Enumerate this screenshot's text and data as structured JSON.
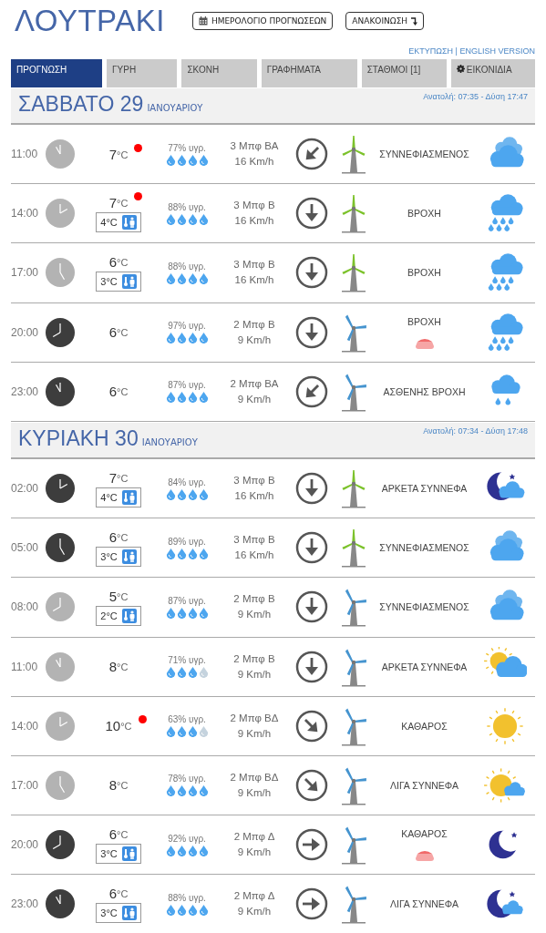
{
  "title": "ΛΟΥΤΡΑΚΙ",
  "header_buttons": [
    {
      "label": "ΗΜΕΡΟΛΟΓΙΟ ΠΡΟΓΝΩΣΕΩΝ",
      "kind": "calendar"
    },
    {
      "label": "ΑΝΑΚΟΙΝΩΣΗ",
      "kind": "announce"
    }
  ],
  "links": [
    "ΕΚΤΥΠΩΣΗ",
    "ENGLISH VERSION"
  ],
  "link_separator": "|",
  "tabs": [
    {
      "label": "ΠΡΟΓΝΩΣΗ",
      "selected": true
    },
    {
      "label": "ΓΥΡΗ",
      "selected": false
    },
    {
      "label": "ΣΚΟΝΗ",
      "selected": false
    },
    {
      "label": "ΓΡΑΦΗΜΑΤΑ",
      "selected": false
    },
    {
      "label": "ΣΤΑΘΜΟΙ  [1]",
      "selected": false
    },
    {
      "label": "ΕΙΚΟΝΙΔΙΑ",
      "selected": false,
      "kind": "gear"
    }
  ],
  "days": [
    {
      "day": "ΣΑΒΒΑΤΟ 29",
      "month": "ΙΑΝΟΥΑΡΙΟΥ",
      "sun": "Ανατολή: 07:35  - Δύση 17:47",
      "rows": [
        {
          "time": "11:00",
          "night": false,
          "temp": "7",
          "unit": "°C",
          "alert": true,
          "humidity": "77% υγρ.",
          "stars": 4,
          "wind_force": "3 Μπφ ΒΑ",
          "wind_speed": "16 Km/h",
          "arrow": {
            "kind": "sw"
          },
          "turbine": {
            "kind": "strong"
          },
          "condition": "ΣΥΝΝΕΦΙΑΣΜΕΝΟΣ",
          "fog": false,
          "weather": {
            "kind": "cloudy"
          }
        },
        {
          "time": "14:00",
          "night": false,
          "temp": "7",
          "unit": "°C",
          "alert": true,
          "feels": "4°C",
          "humidity": "88% υγρ.",
          "stars": 4,
          "wind_force": "3 Μπφ Β",
          "wind_speed": "16 Km/h",
          "arrow": {
            "kind": "s"
          },
          "turbine": {
            "kind": "strong"
          },
          "condition": "ΒΡΟΧΗ",
          "fog": false,
          "weather": {
            "kind": "rain"
          }
        },
        {
          "time": "17:00",
          "night": false,
          "temp": "6",
          "unit": "°C",
          "alert": false,
          "feels": "3°C",
          "humidity": "88% υγρ.",
          "stars": 4,
          "wind_force": "3 Μπφ Β",
          "wind_speed": "16 Km/h",
          "arrow": {
            "kind": "s"
          },
          "turbine": {
            "kind": "strong"
          },
          "condition": "ΒΡΟΧΗ",
          "fog": false,
          "weather": {
            "kind": "rain"
          }
        },
        {
          "time": "20:00",
          "night": true,
          "temp": "6",
          "unit": "°C",
          "alert": false,
          "humidity": "97% υγρ.",
          "stars": 4,
          "wind_force": "2 Μπφ Β",
          "wind_speed": "9 Km/h",
          "arrow": {
            "kind": "s"
          },
          "turbine": {
            "kind": "weak"
          },
          "condition": "ΒΡΟΧΗ",
          "fog": true,
          "weather": {
            "kind": "rain"
          }
        },
        {
          "time": "23:00",
          "night": true,
          "temp": "6",
          "unit": "°C",
          "alert": false,
          "humidity": "87% υγρ.",
          "stars": 4,
          "wind_force": "2 Μπφ ΒΑ",
          "wind_speed": "9 Km/h",
          "arrow": {
            "kind": "sw"
          },
          "turbine": {
            "kind": "weak"
          },
          "condition": "ΑΣΘΕΝΗΣ ΒΡΟΧΗ",
          "fog": false,
          "weather": {
            "kind": "drizzle"
          }
        }
      ]
    },
    {
      "day": "ΚΥΡΙΑΚΗ 30",
      "month": "ΙΑΝΟΥΑΡΙΟΥ",
      "sun": "Ανατολή: 07:34  - Δύση 17:48",
      "rows": [
        {
          "time": "02:00",
          "night": true,
          "temp": "7",
          "unit": "°C",
          "alert": false,
          "feels": "4°C",
          "humidity": "84% υγρ.",
          "stars": 4,
          "wind_force": "3 Μπφ Β",
          "wind_speed": "16 Km/h",
          "arrow": {
            "kind": "s"
          },
          "turbine": {
            "kind": "strong"
          },
          "condition": "ΑΡΚΕΤΑ ΣΥΝΝΕΦΑ",
          "fog": false,
          "weather": {
            "kind": "nightcloud"
          }
        },
        {
          "time": "05:00",
          "night": true,
          "temp": "6",
          "unit": "°C",
          "alert": false,
          "feels": "3°C",
          "humidity": "89% υγρ.",
          "stars": 4,
          "wind_force": "3 Μπφ Β",
          "wind_speed": "16 Km/h",
          "arrow": {
            "kind": "s"
          },
          "turbine": {
            "kind": "strong"
          },
          "condition": "ΣΥΝΝΕΦΙΑΣΜΕΝΟΣ",
          "fog": false,
          "weather": {
            "kind": "cloudy"
          }
        },
        {
          "time": "08:00",
          "night": false,
          "temp": "5",
          "unit": "°C",
          "alert": false,
          "feels": "2°C",
          "humidity": "87% υγρ.",
          "stars": 4,
          "wind_force": "2 Μπφ Β",
          "wind_speed": "9 Km/h",
          "arrow": {
            "kind": "s"
          },
          "turbine": {
            "kind": "weak"
          },
          "condition": "ΣΥΝΝΕΦΙΑΣΜΕΝΟΣ",
          "fog": false,
          "weather": {
            "kind": "cloudy"
          }
        },
        {
          "time": "11:00",
          "night": false,
          "temp": "8",
          "unit": "°C",
          "alert": false,
          "humidity": "71% υγρ.",
          "stars": 3,
          "wind_force": "2 Μπφ Β",
          "wind_speed": "9 Km/h",
          "arrow": {
            "kind": "s"
          },
          "turbine": {
            "kind": "weak"
          },
          "condition": "ΑΡΚΕΤΑ ΣΥΝΝΕΦΑ",
          "fog": false,
          "weather": {
            "kind": "suncloud"
          }
        },
        {
          "time": "14:00",
          "night": false,
          "temp": "10",
          "unit": "°C",
          "alert": true,
          "humidity": "63% υγρ.",
          "stars": 3,
          "wind_force": "2 Μπφ ΒΔ",
          "wind_speed": "9 Km/h",
          "arrow": {
            "kind": "se"
          },
          "turbine": {
            "kind": "weak"
          },
          "condition": "ΚΑΘΑΡΟΣ",
          "fog": false,
          "weather": {
            "kind": "sun"
          }
        },
        {
          "time": "17:00",
          "night": false,
          "temp": "8",
          "unit": "°C",
          "alert": false,
          "humidity": "78% υγρ.",
          "stars": 4,
          "wind_force": "2 Μπφ ΒΔ",
          "wind_speed": "9 Km/h",
          "arrow": {
            "kind": "se"
          },
          "turbine": {
            "kind": "weak"
          },
          "condition": "ΛΙΓΑ ΣΥΝΝΕΦΑ",
          "fog": false,
          "weather": {
            "kind": "sunfew"
          }
        },
        {
          "time": "20:00",
          "night": true,
          "temp": "6",
          "unit": "°C",
          "alert": false,
          "feels": "3°C",
          "humidity": "92% υγρ.",
          "stars": 4,
          "wind_force": "2 Μπφ Δ",
          "wind_speed": "9 Km/h",
          "arrow": {
            "kind": "e"
          },
          "turbine": {
            "kind": "weak"
          },
          "condition": "ΚΑΘΑΡΟΣ",
          "fog": true,
          "weather": {
            "kind": "moon"
          }
        },
        {
          "time": "23:00",
          "night": true,
          "temp": "6",
          "unit": "°C",
          "alert": false,
          "feels": "3°C",
          "humidity": "88% υγρ.",
          "stars": 4,
          "wind_force": "2 Μπφ Δ",
          "wind_speed": "9 Km/h",
          "arrow": {
            "kind": "e"
          },
          "turbine": {
            "kind": "weak"
          },
          "condition": "ΛΙΓΑ ΣΥΝΝΕΦΑ",
          "fog": false,
          "weather": {
            "kind": "moonfew"
          }
        }
      ]
    }
  ]
}
